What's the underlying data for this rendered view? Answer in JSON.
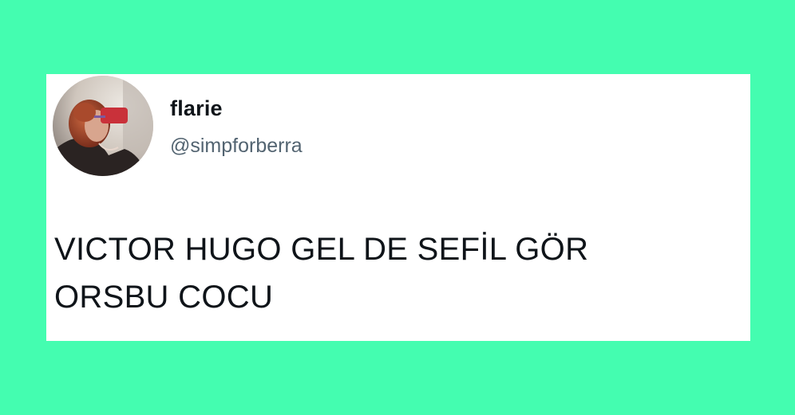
{
  "tweet": {
    "display_name": "flarie",
    "handle": "@simpforberra",
    "text_lines": [
      "VICTOR HUGO GEL DE SEFİL GÖR",
      "ORSBU COCU"
    ]
  },
  "colors": {
    "background": "#44fdb0",
    "card": "#ffffff",
    "name": "#0f1419",
    "handle": "#536471"
  }
}
